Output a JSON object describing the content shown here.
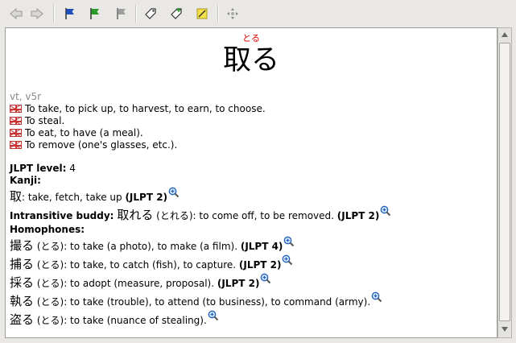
{
  "toolbar": {
    "buttons": [
      {
        "name": "back-button",
        "icon": "arrow-left-icon"
      },
      {
        "name": "forward-button",
        "icon": "arrow-right-icon"
      },
      {
        "name": "flag-blue-button",
        "icon": "flag-blue-icon"
      },
      {
        "name": "flag-green-button",
        "icon": "flag-green-icon"
      },
      {
        "name": "flag-gray-button",
        "icon": "flag-gray-icon"
      },
      {
        "name": "tag-button",
        "icon": "tag-icon"
      },
      {
        "name": "tag-add-button",
        "icon": "tag-add-icon"
      },
      {
        "name": "note-button",
        "icon": "note-icon"
      },
      {
        "name": "move-button",
        "icon": "move-icon"
      }
    ]
  },
  "entry": {
    "reading": "とる",
    "kanji": "取る",
    "pos": "vt, v5r",
    "senses": [
      "To take, to pick up, to harvest, to earn, to choose.",
      "To steal.",
      "To eat, to have (a meal).",
      "To remove (one's glasses, etc.)."
    ],
    "jlpt_label": "JLPT level:",
    "jlpt_value": "4",
    "kanji_label": "Kanji:",
    "kanji_items": [
      {
        "word": "取",
        "rest": ": take, fetch, take up ",
        "jlpt": "(JLPT 2)"
      }
    ],
    "buddy_label": "Intransitive buddy:",
    "buddy": {
      "word": "取れる",
      "rest": " (とれる): to come off, to be removed. ",
      "jlpt": "(JLPT 2)"
    },
    "homophones_label": "Homophones:",
    "homophones": [
      {
        "word": "撮る",
        "rest": " (とる): to take (a photo), to make (a film). ",
        "jlpt": "(JLPT 4)"
      },
      {
        "word": "捕る",
        "rest": " (とる): to take, to catch (fish), to capture. ",
        "jlpt": "(JLPT 2)"
      },
      {
        "word": "採る",
        "rest": " (とる): to adopt (measure, proposal). ",
        "jlpt": "(JLPT 2)"
      },
      {
        "word": "執る",
        "rest": " (とる): to take (trouble), to attend (to business), to command (army).",
        "jlpt": ""
      },
      {
        "word": "盗る",
        "rest": " (とる): to take (nuance of stealing).",
        "jlpt": ""
      }
    ]
  },
  "colors": {
    "furigana": "#dd0000",
    "accent_blue": "#1f5fbf",
    "flag_green": "#2a9a2a"
  }
}
